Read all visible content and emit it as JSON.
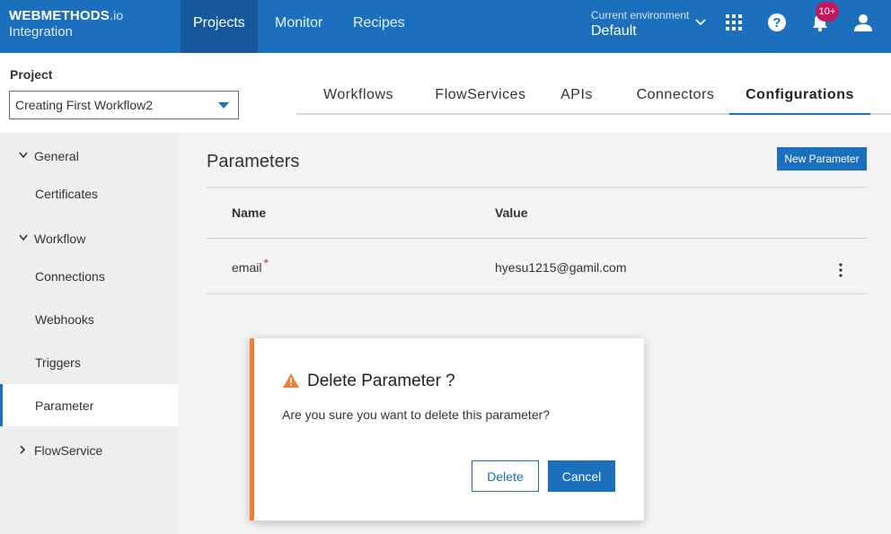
{
  "brand": {
    "name": "WEBMETHODS",
    "suffix": ".io",
    "product": "Integration"
  },
  "topnav": {
    "items": [
      {
        "label": "Projects",
        "active": true
      },
      {
        "label": "Monitor",
        "active": false
      },
      {
        "label": "Recipes",
        "active": false
      }
    ],
    "environment_label": "Current environment",
    "environment_value": "Default",
    "notification_count": "10+",
    "icons": [
      "apps-grid-icon",
      "help-icon",
      "bell-icon",
      "user-icon"
    ]
  },
  "project": {
    "label": "Project",
    "selected": "Creating First Workflow2"
  },
  "tabs": [
    {
      "label": "Workflows",
      "active": false
    },
    {
      "label": "FlowServices",
      "active": false
    },
    {
      "label": "APIs",
      "active": false
    },
    {
      "label": "Connectors",
      "active": false
    },
    {
      "label": "Configurations",
      "active": true
    }
  ],
  "sidebar": {
    "groups": [
      {
        "label": "General",
        "expanded": true,
        "items": [
          "Certificates"
        ]
      },
      {
        "label": "Workflow",
        "expanded": true,
        "items": [
          "Connections",
          "Webhooks",
          "Triggers",
          "Parameter"
        ]
      },
      {
        "label": "FlowService",
        "expanded": false,
        "items": []
      }
    ],
    "selected": "Parameter"
  },
  "main": {
    "title": "Parameters",
    "new_button": "New Parameter",
    "columns": [
      "Name",
      "Value"
    ],
    "rows": [
      {
        "name": "email",
        "required_mark": "*",
        "value": "hyesu1215@gamil.com"
      }
    ]
  },
  "dialog": {
    "title": "Delete Parameter ?",
    "message": "Are you sure you want to delete this parameter?",
    "delete_label": "Delete",
    "cancel_label": "Cancel"
  },
  "colors": {
    "primary": "#1b6fbd",
    "warning": "#f07f33",
    "badge": "#c2185b"
  }
}
